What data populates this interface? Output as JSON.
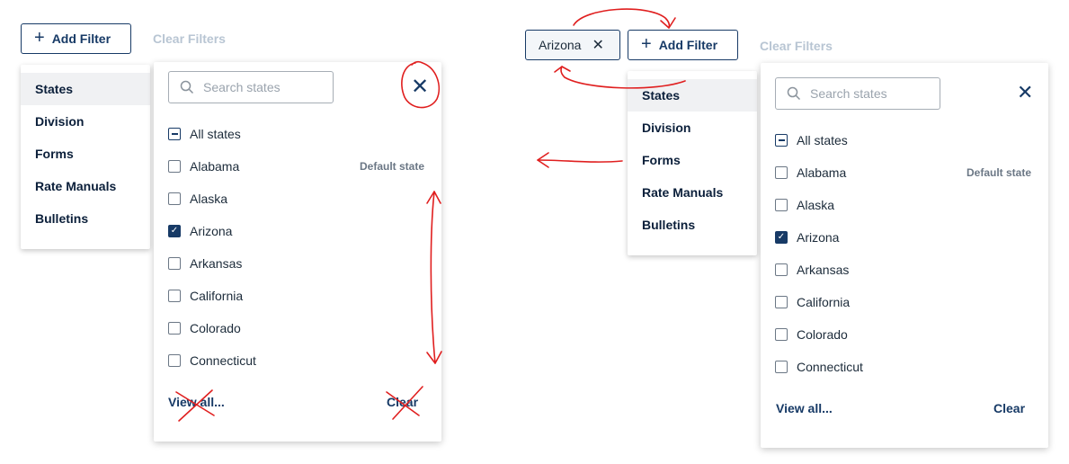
{
  "left": {
    "add_filter": "Add Filter",
    "clear_filters": "Clear Filters",
    "categories": [
      "States",
      "Division",
      "Forms",
      "Rate Manuals",
      "Bulletins"
    ],
    "search_placeholder": "Search states",
    "all_states": "All states",
    "states": [
      "Alabama",
      "Alaska",
      "Arizona",
      "Arkansas",
      "California",
      "Colorado",
      "Connecticut"
    ],
    "default_label": "Default state",
    "view_all": "View all...",
    "clear": "Clear"
  },
  "right": {
    "chip": "Arizona",
    "add_filter": "Add Filter",
    "clear_filters": "Clear Filters",
    "categories": [
      "States",
      "Division",
      "Forms",
      "Rate Manuals",
      "Bulletins"
    ],
    "search_placeholder": "Search states",
    "all_states": "All states",
    "states": [
      "Alabama",
      "Alaska",
      "Arizona",
      "Arkansas",
      "California",
      "Colorado",
      "Connecticut"
    ],
    "default_label": "Default state",
    "view_all": "View all...",
    "clear": "Clear"
  },
  "checked_state": "Arizona",
  "colors": {
    "accent": "#173a66",
    "annotation": "#e01f1f",
    "muted": "#b8c5d3"
  },
  "icons": {
    "plus": "plus-icon",
    "close": "close-icon",
    "search": "search-icon",
    "check": "check-icon"
  }
}
